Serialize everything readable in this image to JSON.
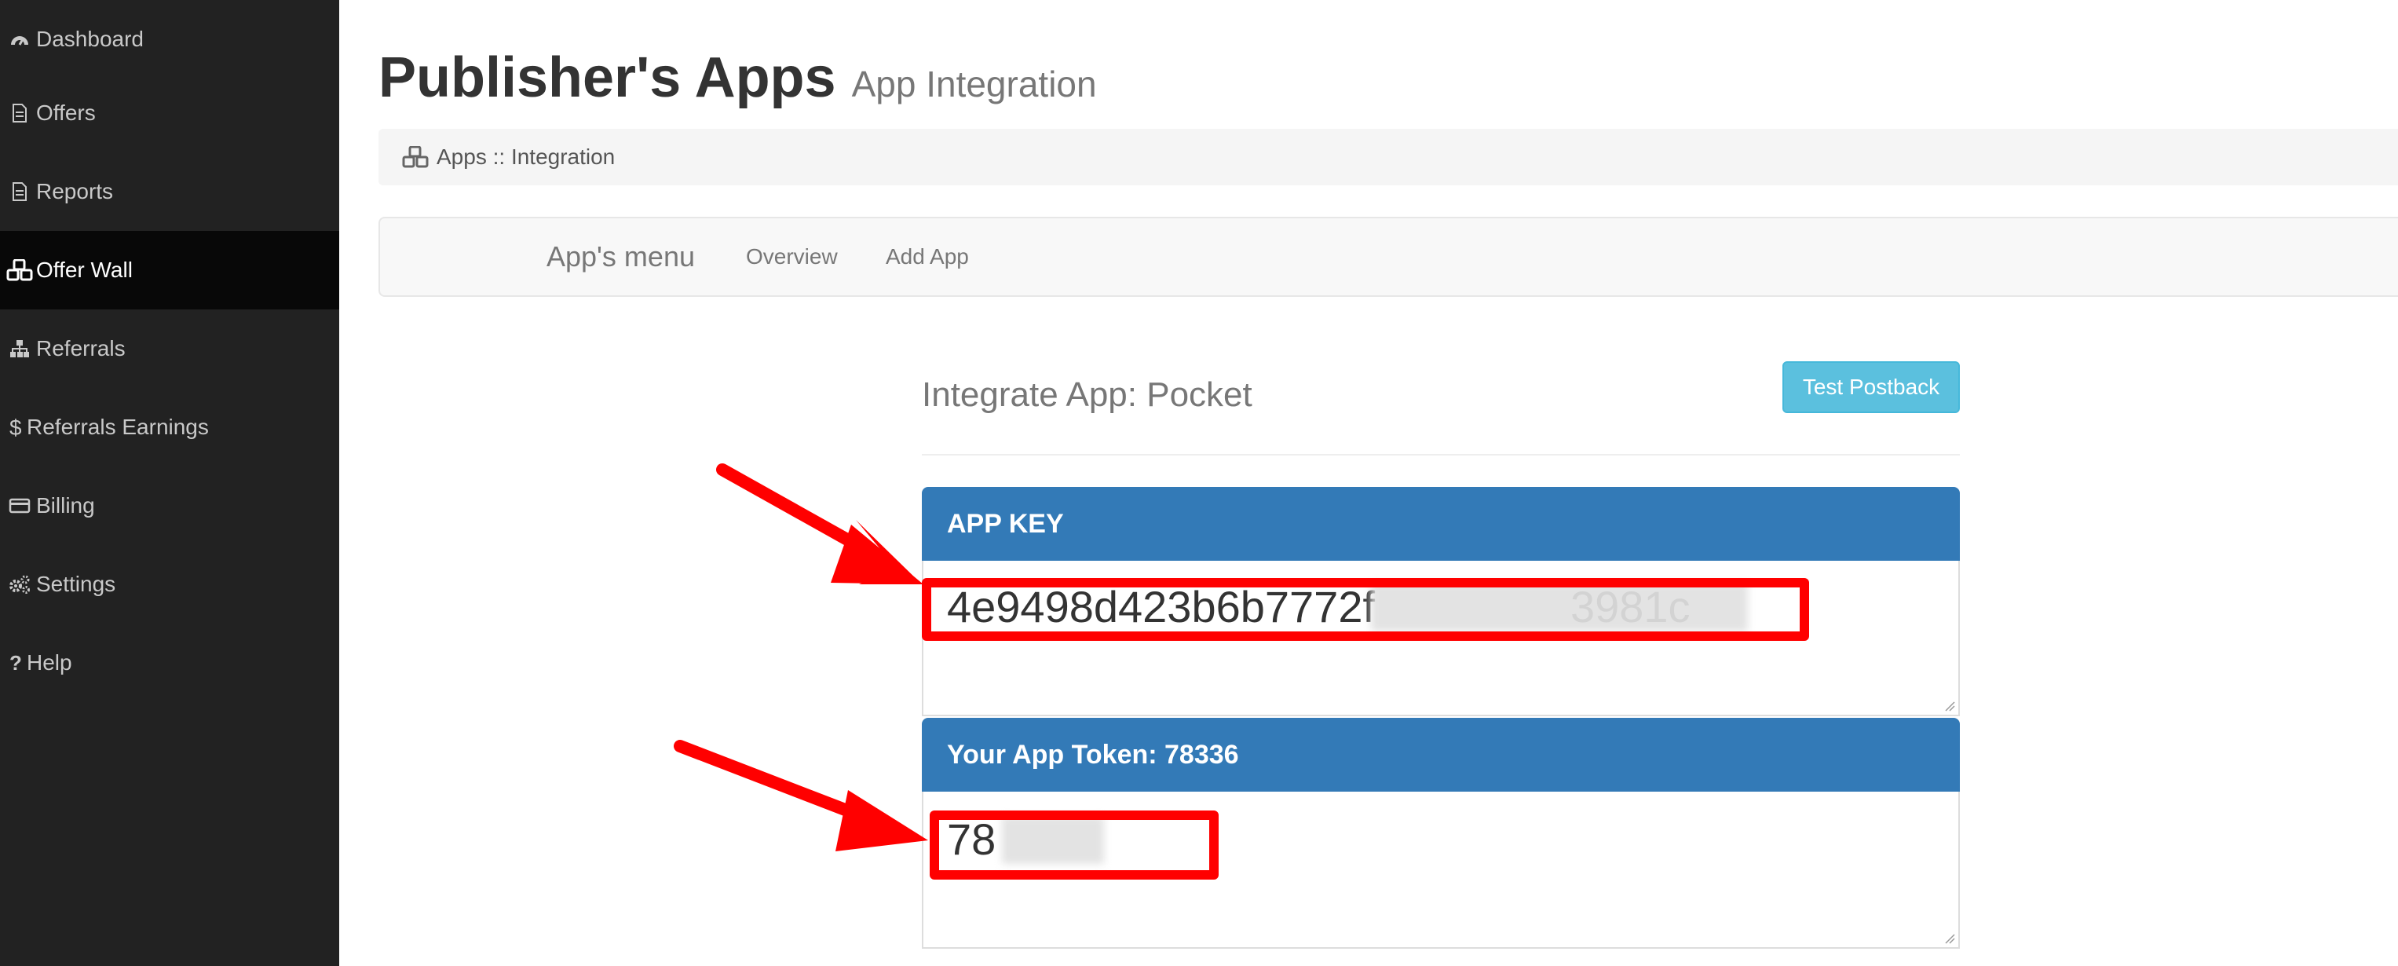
{
  "sidebar": {
    "items": [
      {
        "label": "Dashboard",
        "icon": "dashboard-icon"
      },
      {
        "label": "Offers",
        "icon": "file-icon"
      },
      {
        "label": "Reports",
        "icon": "file-icon"
      },
      {
        "label": "Offer Wall",
        "icon": "cubes-icon",
        "active": true
      },
      {
        "label": "Referrals",
        "icon": "sitemap-icon"
      },
      {
        "label": "Referrals Earnings",
        "icon": "dollar-icon"
      },
      {
        "label": "Billing",
        "icon": "credit-card-icon"
      },
      {
        "label": "Settings",
        "icon": "gears-icon"
      },
      {
        "label": "Help",
        "icon": "question-icon"
      }
    ]
  },
  "header": {
    "title": "Publisher's Apps",
    "subtitle": "App Integration"
  },
  "breadcrumb": {
    "text": "Apps :: Integration",
    "icon": "cubes-icon"
  },
  "app_menu": {
    "brand": "App's menu",
    "links": [
      "Overview",
      "Add App"
    ]
  },
  "integration": {
    "title": "Integrate App: Pocket",
    "test_button": "Test Postback",
    "app_key_heading": "APP KEY",
    "app_key_value": "4e9498d423b6b7772f                3981c",
    "token_heading": "Your App Token: 78336",
    "token_value": "78"
  },
  "colors": {
    "sidebar_bg": "#222222",
    "sidebar_active": "#080808",
    "panel_heading": "#337ab7",
    "info_button": "#5bc0de",
    "annotation": "#ff0000"
  }
}
